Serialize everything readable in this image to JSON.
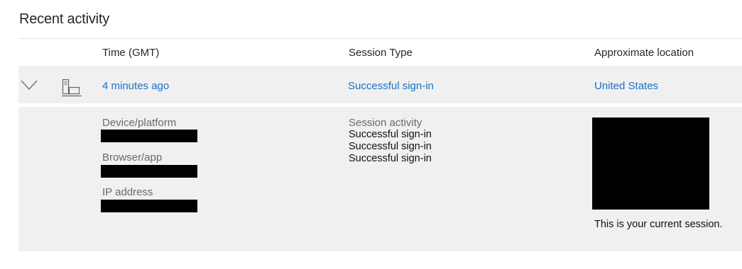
{
  "page": {
    "title": "Recent activity"
  },
  "table": {
    "columns": [
      "Time (GMT)",
      "Session Type",
      "Approximate location"
    ]
  },
  "activity": {
    "time": "4 minutes ago",
    "session_type": "Successful sign-in",
    "location": "United States",
    "expand_icon": "chevron-down-icon",
    "device_icon": "device-computer-icon"
  },
  "details": {
    "device_label": "Device/platform",
    "browser_label": "Browser/app",
    "ip_label": "IP address",
    "session_activity_label": "Session activity",
    "session_activity": [
      "Successful sign-in",
      "Successful sign-in",
      "Successful sign-in"
    ],
    "current_session_note": "This is your current session."
  },
  "colors": {
    "link": "#1a6fc4",
    "row_background": "#f0f0f0",
    "redaction": "#000000"
  }
}
